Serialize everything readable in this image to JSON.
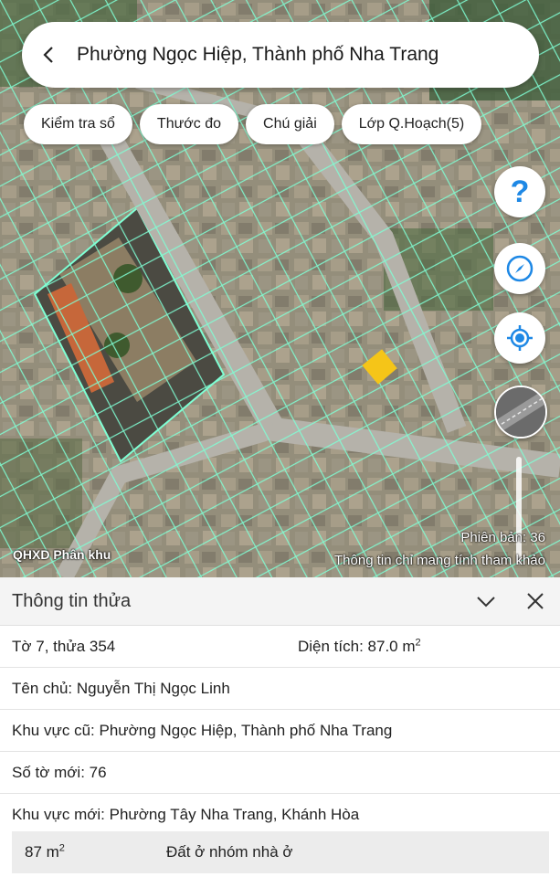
{
  "header": {
    "title": "Phường Ngọc Hiệp, Thành phố Nha Trang"
  },
  "toolbar": {
    "chips": [
      "Kiểm tra sổ",
      "Thước đo",
      "Chú giải",
      "Lớp Q.Hoạch(5)"
    ]
  },
  "map": {
    "layer_label": "QHXD Phân khu",
    "version": "Phiên bản: 36",
    "disclaimer": "Thông tin chỉ mang tính tham khảo",
    "parcel_highlight_color": "#f5c518",
    "boundary_color": "#7fffd4"
  },
  "controls": {
    "help_glyph": "?",
    "icons": [
      "help-icon",
      "compass-icon",
      "my-location-icon",
      "map-layer-thumbnail"
    ]
  },
  "panel": {
    "title": "Thông tin thửa",
    "sheet_parcel": "Tờ 7, thửa 354",
    "area_label": "Diện tích: 87.0 m",
    "area_sup": "2",
    "owner": "Tên chủ: Nguyễn Thị Ngọc Linh",
    "old_region": "Khu vực cũ: Phường Ngọc Hiệp, Thành phố Nha Trang",
    "new_sheet": "Số tờ mới: 76",
    "new_region": "Khu vực mới: Phường Tây Nha Trang, Khánh Hòa",
    "land_use": {
      "area": "87 m",
      "area_sup": "2",
      "type": "Đất ở nhóm nhà ở"
    }
  }
}
